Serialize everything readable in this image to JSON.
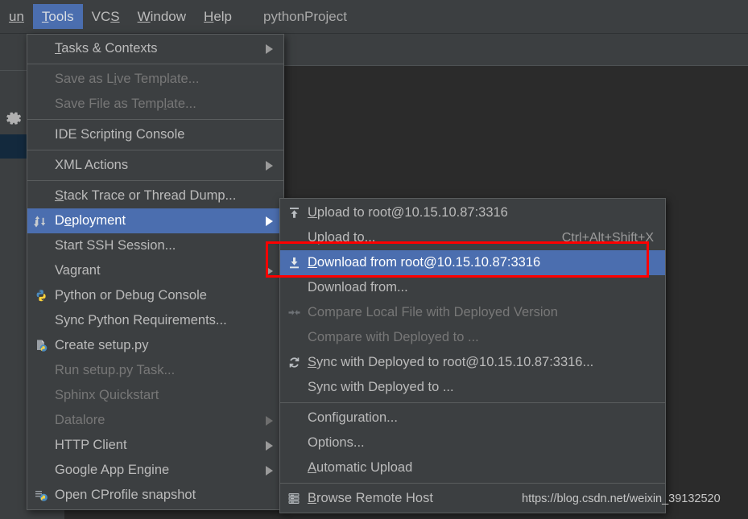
{
  "window": {
    "project_name": "pythonProject"
  },
  "menubar": {
    "items": [
      {
        "label": "un",
        "mnemonic": "",
        "active": false,
        "truncated": true
      },
      {
        "label": "Tools",
        "mnemonic": "T",
        "active": true
      },
      {
        "label": "VCS",
        "mnemonic": "S",
        "active": false
      },
      {
        "label": "Window",
        "mnemonic": "W",
        "active": false
      },
      {
        "label": "Help",
        "mnemonic": "H",
        "active": false
      }
    ]
  },
  "left_rail": {
    "gear_icon": "gear-icon"
  },
  "tools_menu": {
    "title": "Tools",
    "items": [
      {
        "label": "Tasks & Contexts",
        "mnemonic": "T",
        "icon": "",
        "arrow": true,
        "disabled": false,
        "sel": false
      },
      {
        "separator": true
      },
      {
        "label": "Save as Live Template...",
        "mnemonic": "i",
        "icon": "",
        "arrow": false,
        "disabled": true,
        "sel": false
      },
      {
        "label": "Save File as Template...",
        "mnemonic": "l",
        "icon": "",
        "arrow": false,
        "disabled": true,
        "sel": false
      },
      {
        "separator": true
      },
      {
        "label": "IDE Scripting Console",
        "mnemonic": "",
        "icon": "",
        "arrow": false,
        "disabled": false,
        "sel": false
      },
      {
        "separator": true
      },
      {
        "label": "XML Actions",
        "mnemonic": "",
        "icon": "",
        "arrow": true,
        "disabled": false,
        "sel": false
      },
      {
        "separator": true
      },
      {
        "label": "Stack Trace or Thread Dump...",
        "mnemonic": "S",
        "icon": "",
        "arrow": false,
        "disabled": false,
        "sel": false
      },
      {
        "label": "Deployment",
        "mnemonic": "e",
        "icon": "deployment-icon",
        "arrow": true,
        "disabled": false,
        "sel": true
      },
      {
        "label": "Start SSH Session...",
        "mnemonic": "",
        "icon": "",
        "arrow": false,
        "disabled": false,
        "sel": false
      },
      {
        "label": "Vagrant",
        "mnemonic": "",
        "icon": "",
        "arrow": true,
        "disabled": false,
        "sel": false
      },
      {
        "label": "Python or Debug Console",
        "mnemonic": "",
        "icon": "python-console-icon",
        "arrow": false,
        "disabled": false,
        "sel": false
      },
      {
        "label": "Sync Python Requirements...",
        "mnemonic": "",
        "icon": "",
        "arrow": false,
        "disabled": false,
        "sel": false
      },
      {
        "label": "Create setup.py",
        "mnemonic": "",
        "icon": "create-setup-py-icon",
        "arrow": false,
        "disabled": false,
        "sel": false
      },
      {
        "label": "Run setup.py Task...",
        "mnemonic": "",
        "icon": "",
        "arrow": false,
        "disabled": true,
        "sel": false
      },
      {
        "label": "Sphinx Quickstart",
        "mnemonic": "",
        "icon": "",
        "arrow": false,
        "disabled": true,
        "sel": false
      },
      {
        "label": "Datalore",
        "mnemonic": "",
        "icon": "",
        "arrow": true,
        "disabled": true,
        "sel": false
      },
      {
        "label": "HTTP Client",
        "mnemonic": "",
        "icon": "",
        "arrow": true,
        "disabled": false,
        "sel": false
      },
      {
        "label": "Google App Engine",
        "mnemonic": "",
        "icon": "",
        "arrow": true,
        "disabled": false,
        "sel": false
      },
      {
        "label": "Open CProfile snapshot",
        "mnemonic": "",
        "icon": "cprofile-icon",
        "arrow": false,
        "disabled": false,
        "sel": false
      }
    ]
  },
  "deployment_menu": {
    "title": "Deployment",
    "items": [
      {
        "label": "Upload to root@10.15.10.87:3316",
        "mnemonic": "U",
        "icon": "upload-icon",
        "accel": "",
        "disabled": false,
        "sel": false
      },
      {
        "label": "Upload to...",
        "mnemonic": "",
        "icon": "",
        "accel": "Ctrl+Alt+Shift+X",
        "disabled": false,
        "sel": false
      },
      {
        "label": "Download from root@10.15.10.87:3316",
        "mnemonic": "D",
        "icon": "download-icon",
        "accel": "",
        "disabled": false,
        "sel": true
      },
      {
        "label": "Download from...",
        "mnemonic": "",
        "icon": "",
        "accel": "",
        "disabled": false,
        "sel": false
      },
      {
        "label": "Compare Local File with Deployed Version",
        "mnemonic": "",
        "icon": "compare-icon",
        "accel": "",
        "disabled": true,
        "sel": false
      },
      {
        "label": "Compare with Deployed to ...",
        "mnemonic": "",
        "icon": "",
        "accel": "",
        "disabled": true,
        "sel": false
      },
      {
        "label": "Sync with Deployed to root@10.15.10.87:3316...",
        "mnemonic": "S",
        "icon": "sync-icon",
        "accel": "",
        "disabled": false,
        "sel": false
      },
      {
        "label": "Sync with Deployed to ...",
        "mnemonic": "",
        "icon": "",
        "accel": "",
        "disabled": false,
        "sel": false
      },
      {
        "separator": true
      },
      {
        "label": "Configuration...",
        "mnemonic": "",
        "icon": "",
        "accel": "",
        "disabled": false,
        "sel": false
      },
      {
        "label": "Options...",
        "mnemonic": "",
        "icon": "",
        "accel": "",
        "disabled": false,
        "sel": false
      },
      {
        "label": "Automatic Upload",
        "mnemonic": "A",
        "icon": "",
        "accel": "",
        "disabled": false,
        "sel": false
      },
      {
        "separator": true
      },
      {
        "label": "Browse Remote Host",
        "mnemonic": "B",
        "icon": "browse-remote-host-icon",
        "accel": "",
        "disabled": false,
        "sel": false
      }
    ]
  },
  "annotation": {
    "rect_color": "#ff0000",
    "target_label": "Download from root@10.15.10.87:3316"
  },
  "watermark": {
    "text": "https://blog.csdn.net/weixin_39132520"
  },
  "colors": {
    "menu_bg": "#3c3f41",
    "editor_bg": "#2b2b2b",
    "highlight": "#4b6eaf",
    "text": "#bbbbbb",
    "text_disabled": "#777777",
    "separator": "#5a5d5e",
    "annotation_red": "#ff0000"
  }
}
